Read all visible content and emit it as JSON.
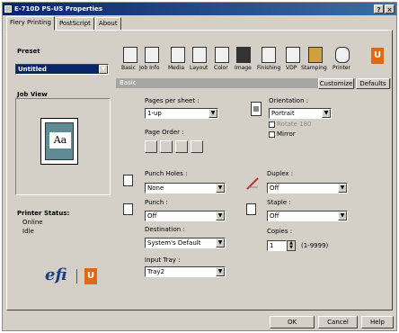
{
  "window": {
    "title": "E-710D PS-US Properties",
    "help_btn": "?",
    "close_btn": "×"
  },
  "tabs": [
    {
      "label": "Fiery Printing"
    },
    {
      "label": "PostScript"
    },
    {
      "label": "About"
    }
  ],
  "preset": {
    "label": "Preset",
    "value": "Untitled"
  },
  "job_view": {
    "label": "Job View",
    "thumb_text": "Aa"
  },
  "printer_status": {
    "label": "Printer Status:",
    "lines": [
      "Online",
      "Idle"
    ]
  },
  "logos": {
    "efi": "efi"
  },
  "toolbar": {
    "items": [
      {
        "label": "Basic",
        "icon": "basic-icon"
      },
      {
        "label": "Job Info",
        "icon": "job-info-icon"
      },
      {
        "label": "Media",
        "icon": "media-icon"
      },
      {
        "label": "Layout",
        "icon": "layout-icon"
      },
      {
        "label": "Color",
        "icon": "color-icon"
      },
      {
        "label": "Image",
        "icon": "image-icon"
      },
      {
        "label": "Finishing",
        "icon": "finishing-icon"
      },
      {
        "label": "VDP",
        "icon": "vdp-icon"
      },
      {
        "label": "Stamping",
        "icon": "stamping-icon"
      },
      {
        "label": "Printer",
        "icon": "printer-icon"
      }
    ],
    "section_title": "Basic",
    "customize_label": "Customize",
    "defaults_label": "Defaults"
  },
  "basic": {
    "pages_per_sheet_label": "Pages per sheet :",
    "pages_per_sheet_value": "1-up",
    "page_order_label": "Page Order :",
    "orientation_label": "Orientation :",
    "orientation_value": "Portrait",
    "rotate_label": "Rotate 180",
    "mirror_label": "Mirror",
    "punch_holes_label": "Punch Holes :",
    "punch_holes_value": "None",
    "punch_label": "Punch :",
    "punch_value": "Off",
    "destination_label": "Destination :",
    "destination_value": "System's Default",
    "input_tray_label": "Input Tray :",
    "input_tray_value": "Tray2",
    "duplex_label": "Duplex :",
    "duplex_value": "Off",
    "staple_label": "Staple :",
    "staple_value": "Off",
    "copies_label": "Copies :",
    "copies_value": "1",
    "copies_range": "(1-9999)"
  },
  "footer": {
    "ok_label": "OK",
    "cancel_label": "Cancel",
    "help_label": "Help"
  }
}
